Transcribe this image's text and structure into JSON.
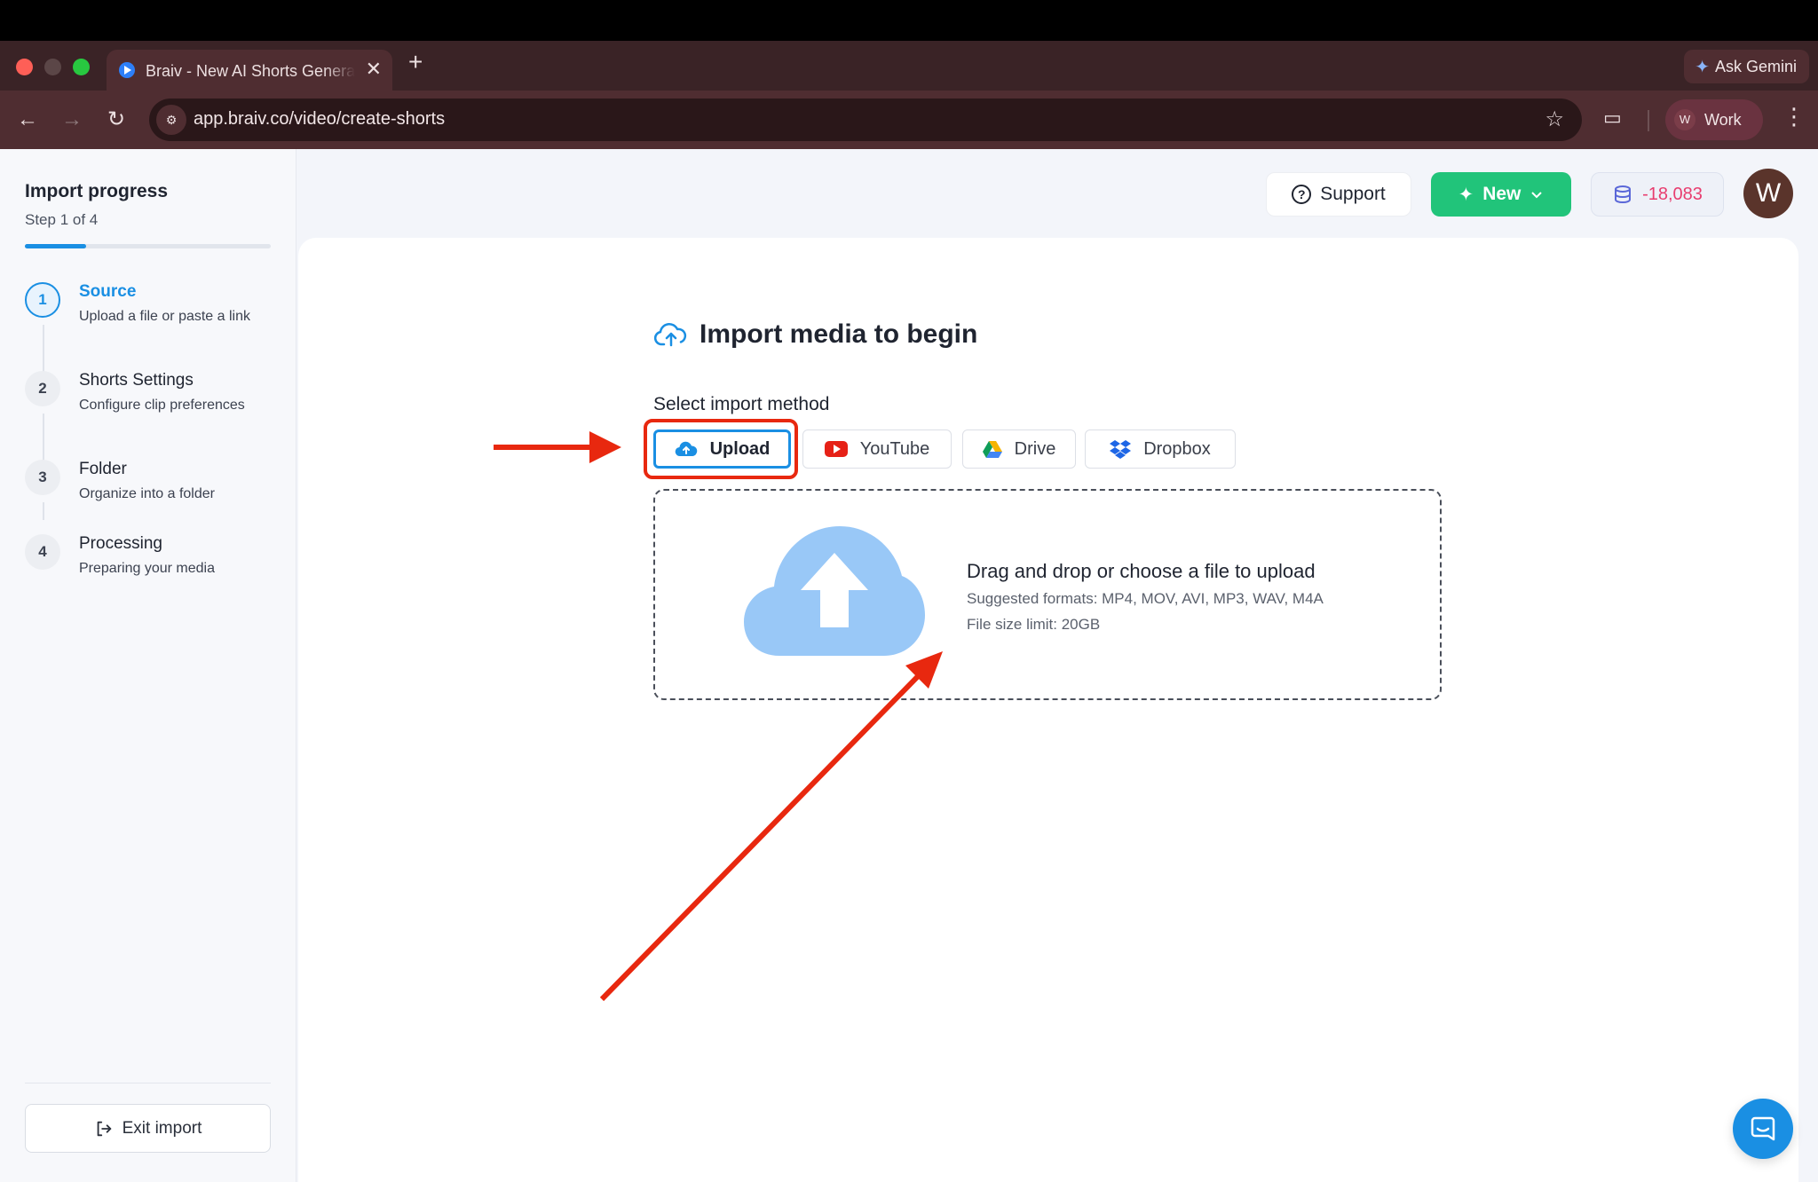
{
  "browser": {
    "tab_title": "Braiv - New AI Shorts Generator",
    "tab_close": "✕",
    "new_tab": "+",
    "ask_gemini": "Ask Gemini",
    "url": "app.braiv.co/video/create-shorts",
    "profile_initial": "W",
    "profile_name": "Work"
  },
  "sidebar": {
    "title": "Import progress",
    "step_counter": "Step 1 of 4",
    "progress_fraction": 0.25,
    "steps": [
      {
        "num": "1",
        "title": "Source",
        "desc": "Upload a file or paste a link"
      },
      {
        "num": "2",
        "title": "Shorts Settings",
        "desc": "Configure clip preferences"
      },
      {
        "num": "3",
        "title": "Folder",
        "desc": "Organize into a folder"
      },
      {
        "num": "4",
        "title": "Processing",
        "desc": "Preparing your media"
      }
    ],
    "exit_label": "Exit import"
  },
  "header": {
    "support_label": "Support",
    "new_label": "New",
    "credits": "-18,083",
    "avatar_initial": "W"
  },
  "main": {
    "title": "Import media to begin",
    "method_label": "Select import method",
    "methods": [
      "Upload",
      "YouTube",
      "Drive",
      "Dropbox"
    ],
    "selected_method": "Upload",
    "dropzone": {
      "title": "Drag and drop or choose a file to upload",
      "formats": "Suggested formats: MP4, MOV, AVI, MP3, WAV, M4A",
      "limit": "File size limit: 20GB"
    }
  },
  "colors": {
    "accent": "#1a8fe3",
    "new_button": "#21c47a",
    "credits_text": "#e83d6f",
    "annotation": "#e8280f"
  },
  "icons": [
    "back-arrow-icon",
    "forward-arrow-icon",
    "reload-icon",
    "site-info-icon",
    "star-icon",
    "gemini-sparkle-icon",
    "question-icon",
    "sparkle-icon",
    "chevron-down-icon",
    "coin-stack-icon",
    "cloud-upload-icon",
    "youtube-icon",
    "google-drive-icon",
    "dropbox-icon",
    "exit-icon",
    "chat-icon"
  ]
}
